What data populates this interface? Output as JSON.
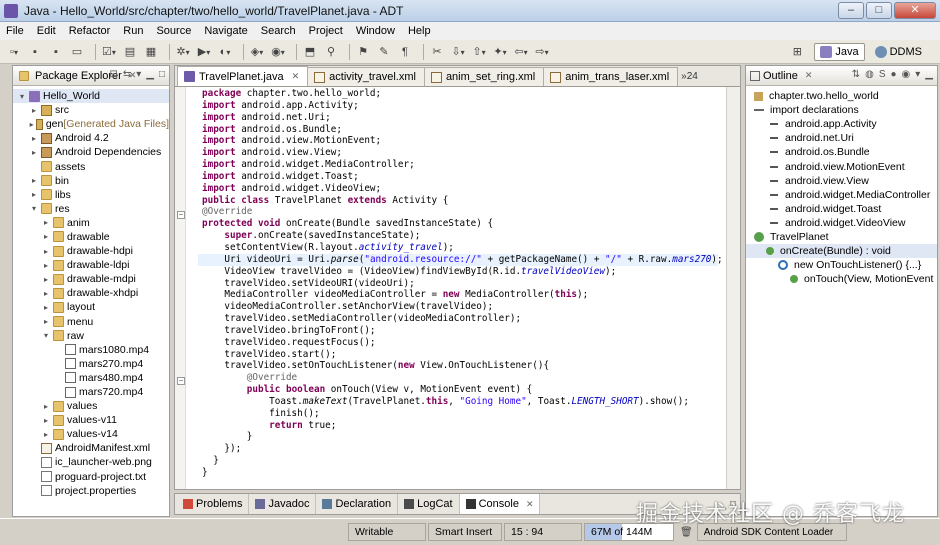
{
  "window": {
    "title": "Java - Hello_World/src/chapter/two/hello_world/TravelPlanet.java - ADT"
  },
  "menu": [
    "File",
    "Edit",
    "Refactor",
    "Run",
    "Source",
    "Navigate",
    "Search",
    "Project",
    "Window",
    "Help"
  ],
  "perspectives": {
    "java": "Java",
    "ddms": "DDMS"
  },
  "package_explorer": {
    "title": "Package Explorer",
    "tree": [
      {
        "indent": 0,
        "twisty": "▾",
        "icon": "project",
        "label": "Hello_World",
        "extra": ""
      },
      {
        "indent": 1,
        "twisty": "▸",
        "icon": "srcfolder",
        "label": "src",
        "extra": ""
      },
      {
        "indent": 1,
        "twisty": "▸",
        "icon": "srcfolder",
        "label": "gen",
        "extra": " [Generated Java Files]"
      },
      {
        "indent": 1,
        "twisty": "▸",
        "icon": "lib",
        "label": "Android 4.2",
        "extra": ""
      },
      {
        "indent": 1,
        "twisty": "▸",
        "icon": "lib",
        "label": "Android Dependencies",
        "extra": ""
      },
      {
        "indent": 1,
        "twisty": "",
        "icon": "folder",
        "label": "assets",
        "extra": ""
      },
      {
        "indent": 1,
        "twisty": "▸",
        "icon": "folder",
        "label": "bin",
        "extra": ""
      },
      {
        "indent": 1,
        "twisty": "▸",
        "icon": "folder",
        "label": "libs",
        "extra": ""
      },
      {
        "indent": 1,
        "twisty": "▾",
        "icon": "folder",
        "label": "res",
        "extra": ""
      },
      {
        "indent": 2,
        "twisty": "▸",
        "icon": "folder",
        "label": "anim",
        "extra": ""
      },
      {
        "indent": 2,
        "twisty": "▸",
        "icon": "folder",
        "label": "drawable",
        "extra": ""
      },
      {
        "indent": 2,
        "twisty": "▸",
        "icon": "folder",
        "label": "drawable-hdpi",
        "extra": ""
      },
      {
        "indent": 2,
        "twisty": "▸",
        "icon": "folder",
        "label": "drawable-ldpi",
        "extra": ""
      },
      {
        "indent": 2,
        "twisty": "▸",
        "icon": "folder",
        "label": "drawable-mdpi",
        "extra": ""
      },
      {
        "indent": 2,
        "twisty": "▸",
        "icon": "folder",
        "label": "drawable-xhdpi",
        "extra": ""
      },
      {
        "indent": 2,
        "twisty": "▸",
        "icon": "folder",
        "label": "layout",
        "extra": ""
      },
      {
        "indent": 2,
        "twisty": "▸",
        "icon": "folder",
        "label": "menu",
        "extra": ""
      },
      {
        "indent": 2,
        "twisty": "▾",
        "icon": "folder",
        "label": "raw",
        "extra": ""
      },
      {
        "indent": 3,
        "twisty": "",
        "icon": "media",
        "label": "mars1080.mp4",
        "extra": ""
      },
      {
        "indent": 3,
        "twisty": "",
        "icon": "media",
        "label": "mars270.mp4",
        "extra": ""
      },
      {
        "indent": 3,
        "twisty": "",
        "icon": "media",
        "label": "mars480.mp4",
        "extra": ""
      },
      {
        "indent": 3,
        "twisty": "",
        "icon": "media",
        "label": "mars720.mp4",
        "extra": ""
      },
      {
        "indent": 2,
        "twisty": "▸",
        "icon": "folder",
        "label": "values",
        "extra": ""
      },
      {
        "indent": 2,
        "twisty": "▸",
        "icon": "folder",
        "label": "values-v11",
        "extra": ""
      },
      {
        "indent": 2,
        "twisty": "▸",
        "icon": "folder",
        "label": "values-v14",
        "extra": ""
      },
      {
        "indent": 1,
        "twisty": "",
        "icon": "xml",
        "label": "AndroidManifest.xml",
        "extra": ""
      },
      {
        "indent": 1,
        "twisty": "",
        "icon": "file",
        "label": "ic_launcher-web.png",
        "extra": ""
      },
      {
        "indent": 1,
        "twisty": "",
        "icon": "file",
        "label": "proguard-project.txt",
        "extra": ""
      },
      {
        "indent": 1,
        "twisty": "",
        "icon": "file",
        "label": "project.properties",
        "extra": ""
      }
    ]
  },
  "editor": {
    "tabs": [
      {
        "label": "TravelPlanet.java",
        "icon": "j",
        "active": true
      },
      {
        "label": "activity_travel.xml",
        "icon": "x",
        "active": false
      },
      {
        "label": "anim_set_ring.xml",
        "icon": "x",
        "active": false
      },
      {
        "label": "anim_trans_laser.xml",
        "icon": "x",
        "active": false
      }
    ],
    "overflow": "»24",
    "code": [
      "package chapter.two.hello_world;",
      "import android.app.Activity;",
      "import android.net.Uri;",
      "import android.os.Bundle;",
      "import android.view.MotionEvent;",
      "import android.view.View;",
      "import android.widget.MediaController;",
      "import android.widget.Toast;",
      "import android.widget.VideoView;",
      "public class TravelPlanet extends Activity {",
      "@Override",
      "protected void onCreate(Bundle savedInstanceState) {",
      "    super.onCreate(savedInstanceState);",
      "    setContentView(R.layout.activity_travel);",
      "    Uri videoUri = Uri.parse(\"android.resource://\" + getPackageName() + \"/\" + R.raw.mars270);",
      "    VideoView travelVideo = (VideoView)findViewById(R.id.travelVideoView);",
      "    travelVideo.setVideoURI(videoUri);",
      "    MediaController videoMediaController = new MediaController(this);",
      "    videoMediaController.setAnchorView(travelVideo);",
      "    travelVideo.setMediaController(videoMediaController);",
      "    travelVideo.bringToFront();",
      "    travelVideo.requestFocus();",
      "    travelVideo.start();",
      "    travelVideo.setOnTouchListener(new View.OnTouchListener(){",
      "        @Override",
      "        public boolean onTouch(View v, MotionEvent event) {",
      "            Toast.makeText(TravelPlanet.this, \"Going Home\", Toast.LENGTH_SHORT).show();",
      "            finish();",
      "            return true;",
      "        }",
      "    });",
      "  }",
      "}"
    ]
  },
  "outline": {
    "title": "Outline",
    "items": [
      {
        "indent": 0,
        "icon": "pkgi",
        "label": "chapter.two.hello_world",
        "selected": false
      },
      {
        "indent": 0,
        "icon": "imp",
        "label": "import declarations",
        "selected": false
      },
      {
        "indent": 1,
        "icon": "impitem",
        "label": "android.app.Activity",
        "selected": false
      },
      {
        "indent": 1,
        "icon": "impitem",
        "label": "android.net.Uri",
        "selected": false
      },
      {
        "indent": 1,
        "icon": "impitem",
        "label": "android.os.Bundle",
        "selected": false
      },
      {
        "indent": 1,
        "icon": "impitem",
        "label": "android.view.MotionEvent",
        "selected": false
      },
      {
        "indent": 1,
        "icon": "impitem",
        "label": "android.view.View",
        "selected": false
      },
      {
        "indent": 1,
        "icon": "impitem",
        "label": "android.widget.MediaController",
        "selected": false
      },
      {
        "indent": 1,
        "icon": "impitem",
        "label": "android.widget.Toast",
        "selected": false
      },
      {
        "indent": 1,
        "icon": "impitem",
        "label": "android.widget.VideoView",
        "selected": false
      },
      {
        "indent": 0,
        "icon": "cls",
        "label": "TravelPlanet",
        "selected": false
      },
      {
        "indent": 1,
        "icon": "meth",
        "label": "onCreate(Bundle) : void",
        "selected": true
      },
      {
        "indent": 2,
        "icon": "anon",
        "label": "new OnTouchListener() {...}",
        "selected": false
      },
      {
        "indent": 3,
        "icon": "meth",
        "label": "onTouch(View, MotionEvent",
        "selected": false
      }
    ]
  },
  "bottom_views": [
    {
      "label": "Problems",
      "active": false,
      "color": "#d04a3a"
    },
    {
      "label": "Javadoc",
      "active": false,
      "color": "#6a6a9a"
    },
    {
      "label": "Declaration",
      "active": false,
      "color": "#5a7a9a"
    },
    {
      "label": "LogCat",
      "active": false,
      "color": "#4a4a4a"
    },
    {
      "label": "Console",
      "active": true,
      "color": "#333333"
    }
  ],
  "status": {
    "writable": "Writable",
    "insert_mode": "Smart Insert",
    "position": "15 : 94",
    "memory": "67M of 144M",
    "loader": "Android SDK Content Loader"
  },
  "watermark": "掘金技术社区 @ 乔客飞龙"
}
